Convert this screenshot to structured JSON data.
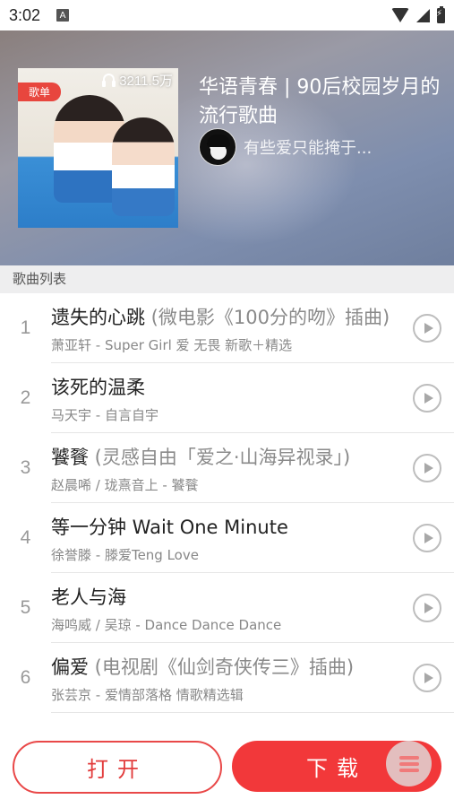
{
  "status_bar": {
    "time": "3:02",
    "notification_icon": "A"
  },
  "playlist": {
    "badge": "歌单",
    "play_count": "3211.5万",
    "title": "华语青春 | 90后校园岁月的流行歌曲",
    "author": "有些爱只能掩于..."
  },
  "section_label": "歌曲列表",
  "songs": [
    {
      "num": "1",
      "title": "遗失的心跳",
      "subtitle": " (微电影《100分的吻》插曲)",
      "meta": "萧亚轩 - Super Girl 爱 无畏 新歌＋精选"
    },
    {
      "num": "2",
      "title": "该死的温柔",
      "subtitle": "",
      "meta": "马天宇 - 自言自宇"
    },
    {
      "num": "3",
      "title": "饕餮",
      "subtitle": " (灵感自由「爱之·山海异视录」)",
      "meta": "赵晨唏 / 珑熹音上 - 饕餮"
    },
    {
      "num": "4",
      "title": "等一分钟 Wait One Minute",
      "subtitle": "",
      "meta": "徐誉滕 - 滕爱Teng Love"
    },
    {
      "num": "5",
      "title": "老人与海",
      "subtitle": "",
      "meta": "海鸣威 / 吴琼 - Dance Dance Dance"
    },
    {
      "num": "6",
      "title": "偏爱",
      "subtitle": " (电视剧《仙剑奇侠传三》插曲)",
      "meta": "张芸京 - 爱情部落格 情歌精选辑"
    }
  ],
  "actions": {
    "open_label": "打开",
    "download_label": "下载"
  },
  "colors": {
    "accent": "#f2383a",
    "badge": "#e8463e"
  }
}
